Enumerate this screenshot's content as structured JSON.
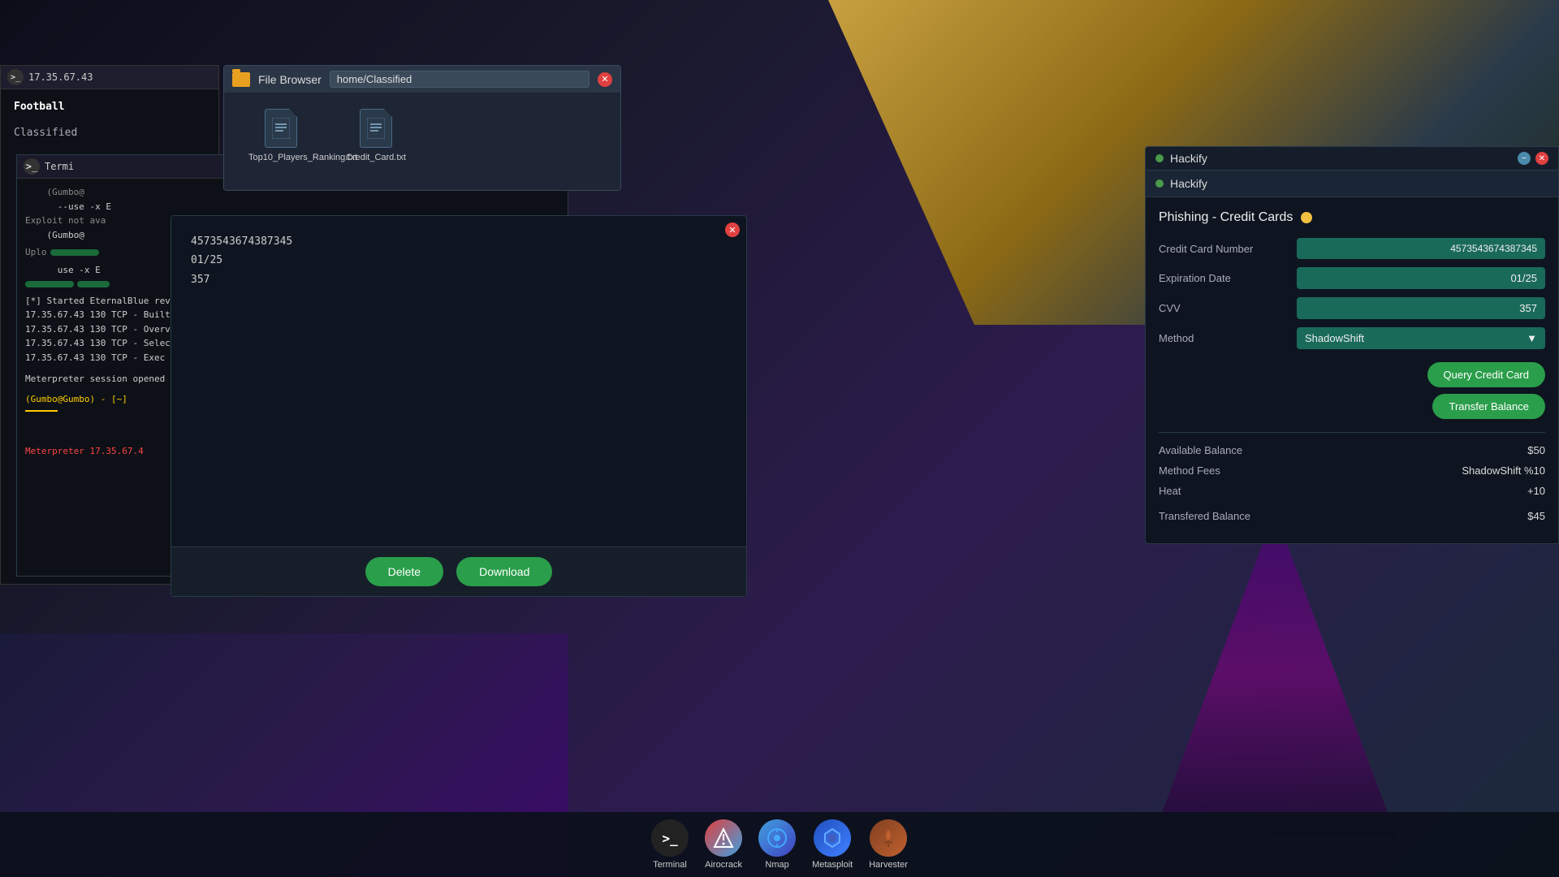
{
  "desktop": {
    "bg_note": "hacker desktop background"
  },
  "terminal_bg": {
    "title": "Term",
    "ip": "17.35.67.43",
    "items": [
      "Football",
      "Classified"
    ]
  },
  "file_browser": {
    "title": "File Browser",
    "path": "home/Classified",
    "files": [
      {
        "name": "Top10_Players_Ranking.txt",
        "icon": "📄"
      },
      {
        "name": "Credit_Card.txt",
        "icon": "📄"
      }
    ]
  },
  "terminal_main": {
    "title": "Termi",
    "lines": [
      "(Gumbo@",
      "use -x E",
      "Exploit not ava",
      "(Gumbo@",
      "use -x E",
      "[*] Started EternalBlue revers",
      "17.35.67.43 130 TCP - Built",
      "17.35.67.43 130 TCP - Overv",
      "17.35.67.43 130 TCP - Selec",
      "17.35.67.43 130 TCP - Exec",
      "",
      "Meterpreter session opened (",
      "",
      "(Gumbo@Gumbo) - [~]",
      "",
      "Meterpreter 17.35.67.4"
    ]
  },
  "file_viewer": {
    "content_lines": [
      "4573543674387345",
      "01/25",
      "357"
    ],
    "btn_delete": "Delete",
    "btn_download": "Download"
  },
  "hackify": {
    "window_title": "Hackify",
    "nav_title": "Hackify",
    "phishing_title": "Phishing - Credit Cards",
    "status_dot_color": "#f0c040",
    "fields": {
      "cc_label": "Credit Card Number",
      "cc_value": "4573543674387345",
      "exp_label": "Expiration Date",
      "exp_value": "01/25",
      "cvv_label": "CVV",
      "cvv_value": "357",
      "method_label": "Method",
      "method_value": "ShadowShift",
      "method_arrow": "▼"
    },
    "buttons": {
      "query": "Query Credit Card",
      "transfer": "Transfer Balance"
    },
    "info": {
      "balance_label": "Available Balance",
      "balance_value": "$50",
      "fees_label": "Method Fees",
      "fees_value": "ShadowShift %10",
      "heat_label": "Heat",
      "heat_value": "+10",
      "transferred_label": "Transfered Balance",
      "transferred_value": "$45"
    }
  },
  "taskbar": {
    "items": [
      {
        "label": "Terminal",
        "icon": ">_",
        "name": "terminal"
      },
      {
        "label": "Airocrack",
        "icon": "⚡",
        "name": "airocrack"
      },
      {
        "label": "Nmap",
        "icon": "👁",
        "name": "nmap"
      },
      {
        "label": "Metasploit",
        "icon": "🛡",
        "name": "metasploit"
      },
      {
        "label": "Harvester",
        "icon": "🌾",
        "name": "harvester"
      }
    ]
  }
}
